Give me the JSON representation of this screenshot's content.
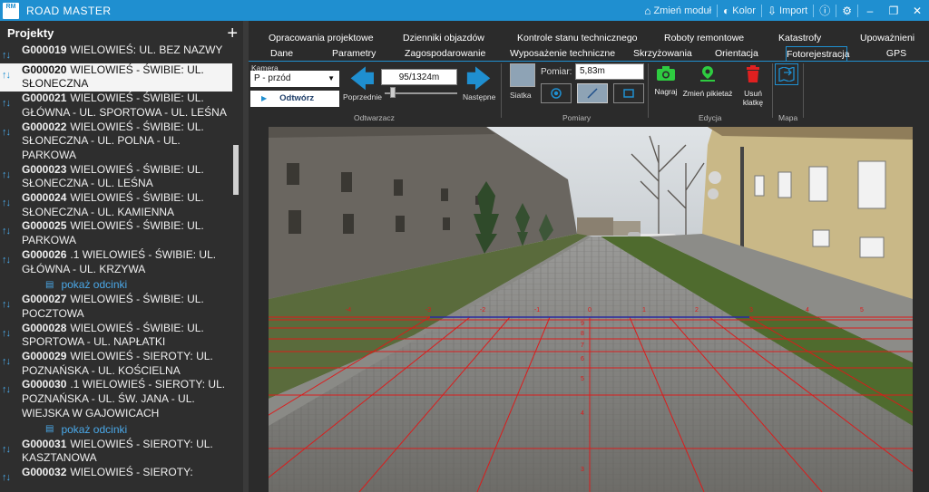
{
  "titlebar": {
    "logo": "RM",
    "title": "ROAD MASTER",
    "buttons": [
      {
        "icon": "home-icon",
        "label": "Zmień moduł"
      },
      {
        "icon": "palette-icon",
        "label": "Kolor"
      },
      {
        "icon": "import-icon",
        "label": "Import"
      }
    ],
    "info_icon": "info-icon",
    "settings_icon": "gear-icon",
    "window": [
      "minimize-icon",
      "restore-icon",
      "close-icon"
    ]
  },
  "left": {
    "title": "Projekty",
    "add_icon": "plus-icon",
    "items": [
      {
        "code": "G000019",
        "text": "G000019 WIELOWIEŚ: UL. BEZ NAZWY"
      },
      {
        "code": "G000020",
        "text": "G000020 WIELOWIEŚ - ŚWIBIE: UL. SŁONECZNA"
      },
      {
        "code": "G000021",
        "text": "G000021 WIELOWIEŚ - ŚWIBIE: UL. GŁÓWNA - UL. SPORTOWA - UL. LEŚNA"
      },
      {
        "code": "G000022",
        "text": "G000022 WIELOWIEŚ - ŚWIBIE: UL. SŁONECZNA - UL. POLNA - UL. PARKOWA"
      },
      {
        "code": "G000023",
        "text": "G000023 WIELOWIEŚ - ŚWIBIE: UL. SŁONECZNA - UL. LEŚNA"
      },
      {
        "code": "G000024",
        "text": "G000024 WIELOWIEŚ - ŚWIBIE: UL. SŁONECZNA - UL. KAMIENNA"
      },
      {
        "code": "G000025",
        "text": "G000025 WIELOWIEŚ - ŚWIBIE: UL. PARKOWA"
      },
      {
        "code": "G000026",
        "text": "G000026.1 WIELOWIEŚ - ŚWIBIE: UL. GŁÓWNA - UL. KRZYWA"
      },
      {
        "code": "G000027",
        "text": "G000027 WIELOWIEŚ - ŚWIBIE: UL. POCZTOWA"
      },
      {
        "code": "G000028",
        "text": "G000028 WIELOWIEŚ - ŚWIBIE: UL. SPORTOWA - UL. NAPŁATKI"
      },
      {
        "code": "G000029",
        "text": "G000029 WIELOWIEŚ - SIEROTY: UL. POZNAŃSKA - UL. KOŚCIELNA"
      },
      {
        "code": "G000030",
        "text": "G000030.1 WIELOWIEŚ - SIEROTY: UL. POZNAŃSKA - UL. ŚW. JANA - UL. WIEJSKA W GAJOWICACH"
      },
      {
        "code": "G000031",
        "text": "G000031 WIELOWIEŚ - SIEROTY: UL. KASZTANOWA"
      },
      {
        "code": "G000032",
        "text": "G000032 WIELOWIEŚ - SIEROTY:"
      }
    ],
    "link_label": "pokaż odcinki"
  },
  "tabs_row1": [
    "Opracowania projektowe",
    "Dzienniki objazdów",
    "Kontrole stanu technicznego",
    "Roboty remontowe",
    "Katastrofy",
    "Upoważnieni"
  ],
  "tabs_row2": [
    "Dane",
    "Parametry",
    "Zagospodarowanie",
    "Wyposażenie techniczne",
    "Skrzyżowania",
    "Orientacja",
    "Fotorejestracja",
    "GPS"
  ],
  "ribbon": {
    "camera_label": "Kamera",
    "camera_value": "P - przód",
    "open_label": "Odtwórz",
    "prev_label": "Poprzednie",
    "next_label": "Następne",
    "counter": "95/1324m",
    "player_group": "Odtwarzacz",
    "grid_label": "Siatka",
    "measure_label": "Pomiar:",
    "measure_value": "5,83m",
    "measure_group": "Pomiary",
    "record_label": "Nagraj",
    "change_label": "Zmień pikietaż",
    "delete_label": "Usuń klatkę",
    "edit_group": "Edycja",
    "map_group": "Mapa"
  },
  "colors": {
    "accent": "#1f8fd0",
    "record": "#2ecc40",
    "delete": "#e02020",
    "grid": "#e01818"
  },
  "photo": {
    "grid_top_labels": [
      "-4",
      "-3",
      "-2",
      "-1",
      "0",
      "1",
      "2",
      "3",
      "4",
      "5"
    ],
    "grid_row_labels": [
      "9",
      "8",
      "7",
      "6",
      "5",
      "4",
      "3"
    ]
  }
}
